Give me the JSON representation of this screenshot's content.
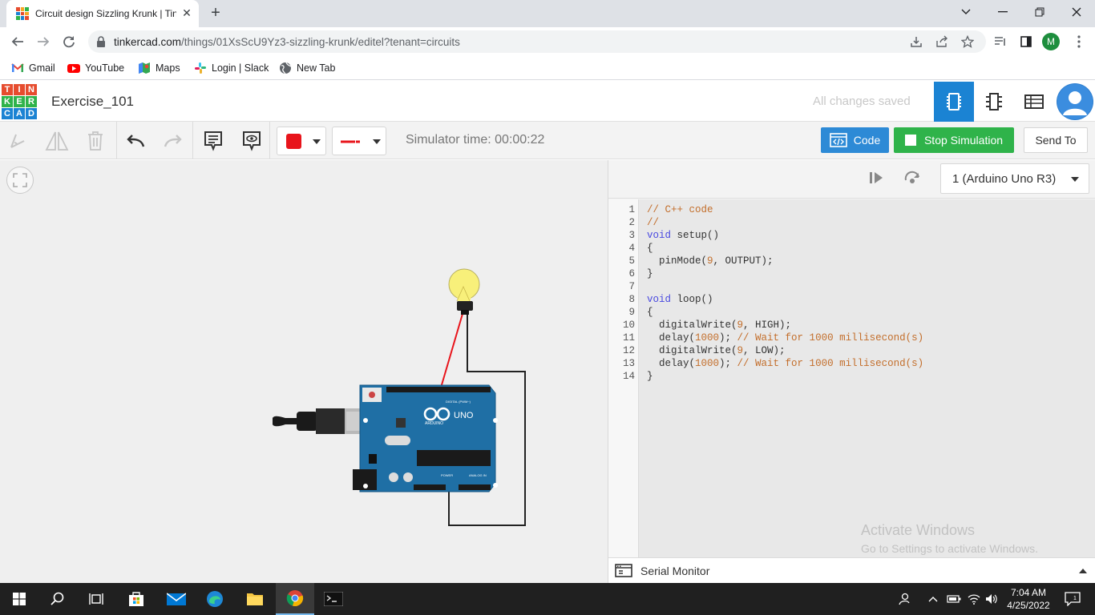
{
  "browser": {
    "tab_title": "Circuit design Sizzling Krunk | Tin",
    "url_host": "tinkercad.com",
    "url_path": "/things/01XsScU9Yz3-sizzling-krunk/editel?tenant=circuits",
    "profile_initial": "M"
  },
  "bookmarks": [
    {
      "label": "Gmail",
      "icon": "gmail-icon"
    },
    {
      "label": "YouTube",
      "icon": "youtube-icon"
    },
    {
      "label": "Maps",
      "icon": "maps-icon"
    },
    {
      "label": "Login | Slack",
      "icon": "slack-icon"
    },
    {
      "label": "New Tab",
      "icon": "globe-icon"
    }
  ],
  "app": {
    "logo_letters": [
      "T",
      "I",
      "N",
      "K",
      "E",
      "R",
      "C",
      "A",
      "D"
    ],
    "project_title": "Exercise_101",
    "save_status": "All changes saved"
  },
  "toolbar": {
    "sim_time": "Simulator time: 00:00:22",
    "code_label": "Code",
    "stop_label": "Stop Simulation",
    "send_label": "Send To",
    "color": "#e8141b"
  },
  "code_panel": {
    "device": "1 (Arduino Uno R3)",
    "serial_label": "Serial Monitor",
    "lines": [
      {
        "n": "1",
        "text": "// C++ code"
      },
      {
        "n": "2",
        "text": "//"
      },
      {
        "n": "3",
        "text": "void setup()"
      },
      {
        "n": "4",
        "text": "{"
      },
      {
        "n": "5",
        "text": "  pinMode(9, OUTPUT);"
      },
      {
        "n": "6",
        "text": "}"
      },
      {
        "n": "7",
        "text": ""
      },
      {
        "n": "8",
        "text": "void loop()"
      },
      {
        "n": "9",
        "text": "{"
      },
      {
        "n": "10",
        "text": "  digitalWrite(9, HIGH);"
      },
      {
        "n": "11",
        "text": "  delay(1000); // Wait for 1000 millisecond(s)"
      },
      {
        "n": "12",
        "text": "  digitalWrite(9, LOW);"
      },
      {
        "n": "13",
        "text": "  delay(1000); // Wait for 1000 millisecond(s)"
      },
      {
        "n": "14",
        "text": "}"
      }
    ]
  },
  "board": {
    "label": "UNO",
    "brand": "ARDUINO",
    "digital_label": "DIGITAL (PWM~)",
    "power_label": "POWER",
    "analog_label": "ANALOG IN"
  },
  "watermark": {
    "title": "Activate Windows",
    "subtitle": "Go to Settings to activate Windows."
  },
  "taskbar": {
    "time": "7:04 AM",
    "date": "4/25/2022"
  }
}
